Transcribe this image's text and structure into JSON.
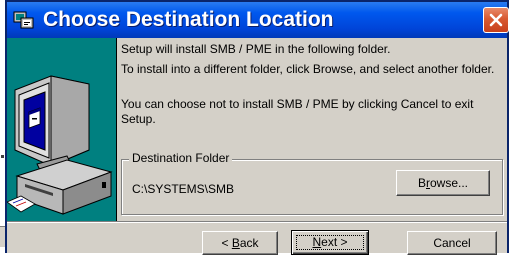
{
  "window": {
    "title": "Choose Destination Location",
    "title_bar_color": "#0054e3",
    "close_button_color": "#d8542c"
  },
  "content": {
    "line1": "Setup will install SMB / PME in the following folder.",
    "line2": "To install into a different folder, click Browse, and select another folder.",
    "line3": "You can choose not to install SMB / PME by clicking Cancel to exit Setup."
  },
  "destination": {
    "legend": "Destination Folder",
    "path": "C:\\SYSTEMS\\SMB",
    "browse_pre": "B",
    "browse_acc": "r",
    "browse_post": "owse..."
  },
  "buttons": {
    "back_pre": "< ",
    "back_acc": "B",
    "back_post": "ack",
    "next_acc": "N",
    "next_post": "ext >",
    "cancel": "Cancel"
  }
}
